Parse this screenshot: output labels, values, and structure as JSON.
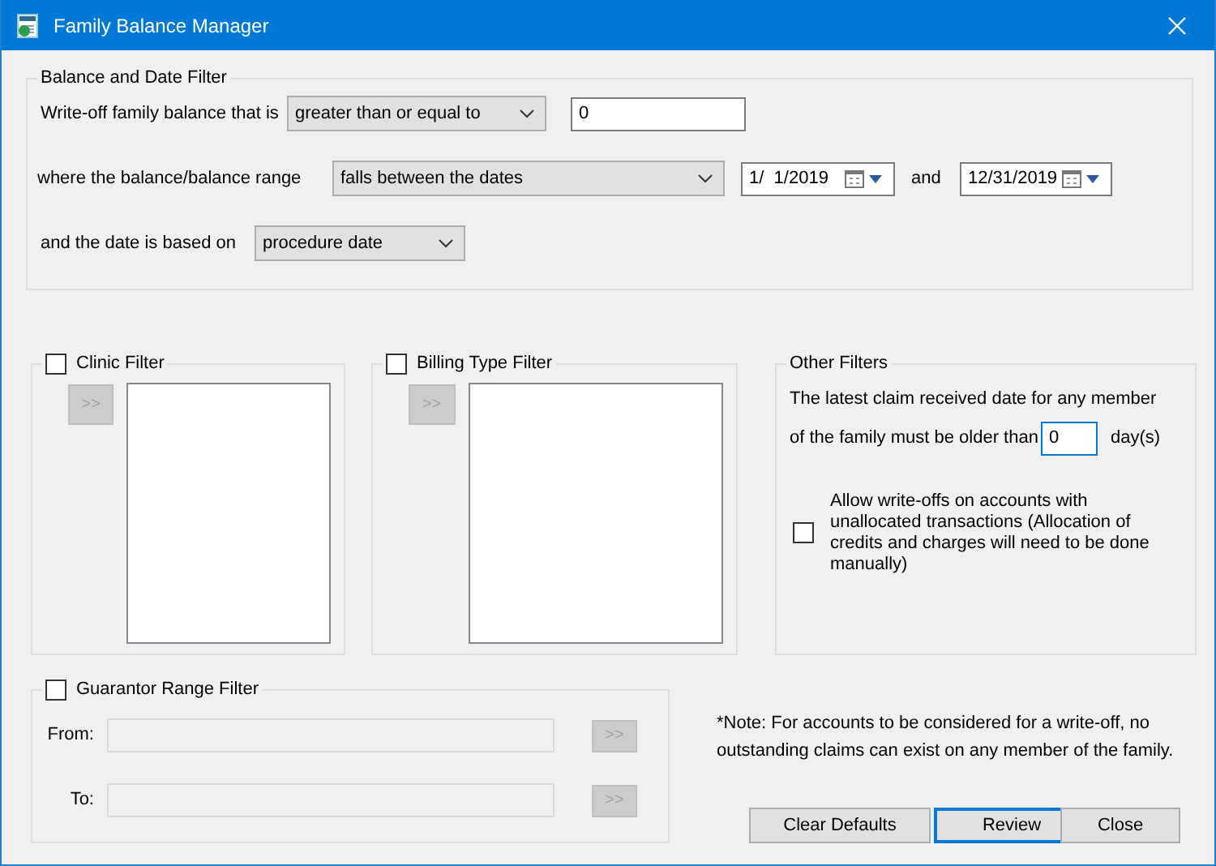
{
  "window": {
    "title": "Family Balance Manager"
  },
  "balance_date_filter": {
    "title": "Balance and Date Filter",
    "balance_label": "Write-off family balance that is",
    "balance_operator": "greater than or equal to",
    "balance_value": "0",
    "range_label": "where the balance/balance range",
    "range_option": "falls between the dates",
    "start_date": "1/  1/2019",
    "and_label": "and",
    "end_date": "12/31/2019",
    "date_basis_label": "and the date is based on",
    "date_basis": "procedure date"
  },
  "list_filters": [
    {
      "label": "Clinic Filter",
      "checked": false,
      "add_button": ">>",
      "add_disabled": true
    },
    {
      "label": "Billing Type Filter",
      "checked": false,
      "add_button": ">>",
      "add_disabled": true
    }
  ],
  "other_filters": {
    "title": "Other Filters",
    "claim_text_1": "The latest claim received date for any member",
    "claim_text_2": "of the family must be older than",
    "days_value": "0",
    "days_focused": true,
    "days_unit": "day(s)",
    "allow_unallocated": {
      "label": "Allow write-offs on accounts with unallocated transactions (Allocation of credits and charges will need to be done manually)",
      "checked": false
    }
  },
  "guarantor_filter": {
    "label": "Guarantor Range Filter",
    "checked": false,
    "fields": [
      {
        "label": "From:",
        "disabled": true,
        "button": ">>"
      },
      {
        "label": "To:",
        "disabled": true,
        "button": ">>"
      }
    ]
  },
  "note": "*Note: For accounts to be considered for a write-off, no outstanding claims can exist on any member of the family.",
  "buttons": [
    {
      "label": "Clear Defaults",
      "default": false
    },
    {
      "label": "Review",
      "default": true
    },
    {
      "label": "Close",
      "default": false
    }
  ]
}
